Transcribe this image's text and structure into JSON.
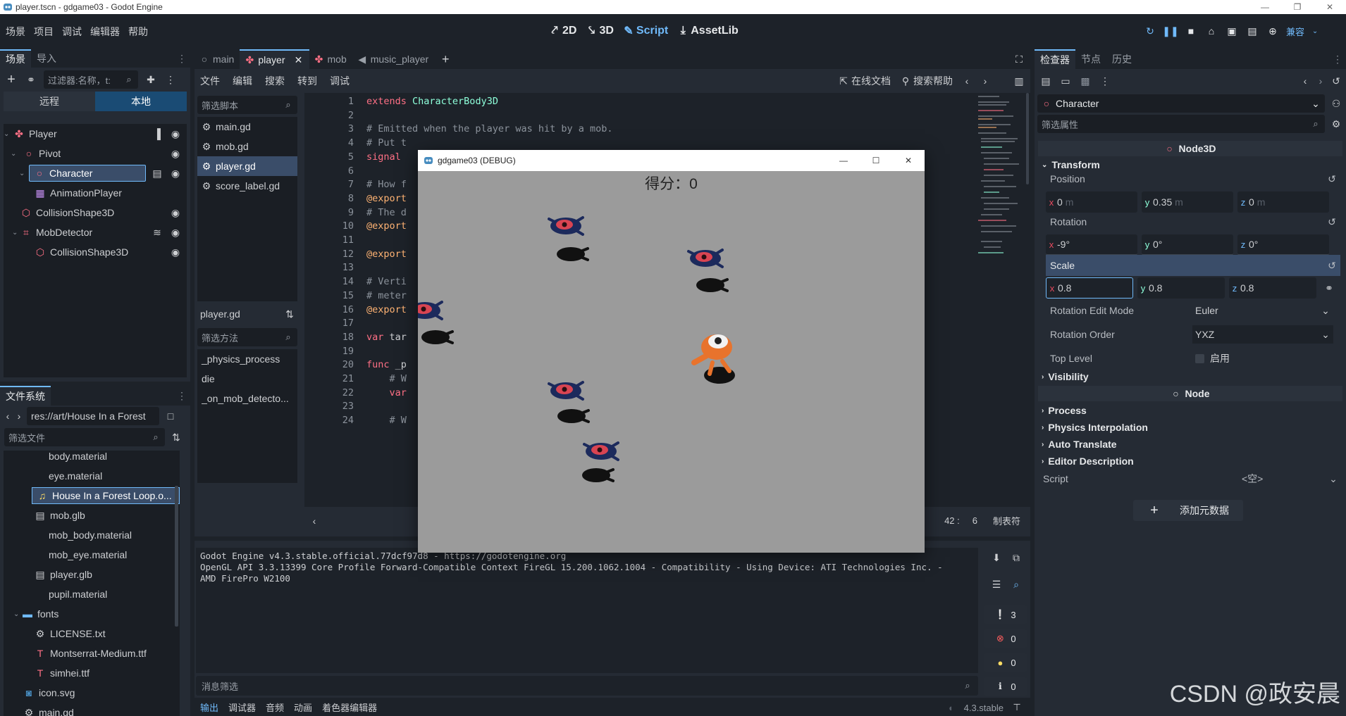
{
  "window_title": "player.tscn - gdgame03 - Godot Engine",
  "menu": [
    "场景",
    "项目",
    "调试",
    "编辑器",
    "帮助"
  ],
  "workspaces": [
    {
      "label": "2D",
      "icon": "2d-icon"
    },
    {
      "label": "3D",
      "icon": "3d-icon"
    },
    {
      "label": "Script",
      "icon": "script-icon"
    },
    {
      "label": "AssetLib",
      "icon": "assetlib-icon"
    }
  ],
  "renderer": "兼容",
  "scene_dock": {
    "tabs": [
      "场景",
      "导入"
    ],
    "filter_placeholder": "过滤器:名称，t:",
    "remote_label": "远程",
    "local_label": "本地",
    "tree": [
      {
        "label": "Player"
      },
      {
        "label": "Pivot"
      },
      {
        "label": "Character"
      },
      {
        "label": "AnimationPlayer"
      },
      {
        "label": "CollisionShape3D"
      },
      {
        "label": "MobDetector"
      },
      {
        "label": "CollisionShape3D"
      }
    ]
  },
  "fs_dock": {
    "title": "文件系统",
    "path": "res://art/House In a Forest",
    "filter_placeholder": "筛选文件",
    "items": [
      {
        "label": "body.material"
      },
      {
        "label": "eye.material"
      },
      {
        "label": "House In a Forest Loop.o..."
      },
      {
        "label": "mob.glb"
      },
      {
        "label": "mob_body.material"
      },
      {
        "label": "mob_eye.material"
      },
      {
        "label": "player.glb"
      },
      {
        "label": "pupil.material"
      },
      {
        "label": "fonts"
      },
      {
        "label": "LICENSE.txt"
      },
      {
        "label": "Montserrat-Medium.ttf"
      },
      {
        "label": "simhei.ttf"
      },
      {
        "label": "icon.svg"
      },
      {
        "label": "main.gd"
      }
    ]
  },
  "script_editor": {
    "tabs": [
      "main",
      "player",
      "mob",
      "music_player"
    ],
    "menu": [
      "文件",
      "编辑",
      "搜索",
      "转到",
      "调试"
    ],
    "online_docs": "在线文档",
    "search_help": "搜索帮助",
    "filter_scripts": "筛选脚本",
    "scripts": [
      "main.gd",
      "mob.gd",
      "player.gd",
      "score_label.gd"
    ],
    "current_script": "player.gd",
    "filter_methods": "筛选方法",
    "methods": [
      "_physics_process",
      "die",
      "_on_mob_detecto..."
    ],
    "line_numbers": [
      "1",
      "2",
      "3",
      "4",
      "5",
      "6",
      "7",
      "8",
      "9",
      "10",
      "11",
      "12",
      "13",
      "14",
      "15",
      "16",
      "17",
      "18",
      "19",
      "20",
      "21",
      "22",
      "23",
      "24"
    ],
    "code_lines": [
      "extends CharacterBody3D",
      "",
      "# Emitted when the player was hit by a mob.",
      "# Put t",
      "signal ",
      "",
      "# How f",
      "@export",
      "# The d",
      "@export",
      "",
      "@export",
      "",
      "# Verti",
      "# meter",
      "@export",
      "",
      "var tar",
      "",
      "func _p",
      "\t# W",
      "\tvar",
      "",
      "\t# W"
    ],
    "status_line": "42 :",
    "status_col": "6",
    "status_tab": "制表符"
  },
  "output": {
    "lines": [
      "Godot Engine v4.3.stable.official.77dcf97d8 - https://godotengine.org",
      "OpenGL API 3.3.13399 Core Profile Forward-Compatible Context FireGL 15.200.1062.1004 - Compatibility - Using Device: ATI Technologies Inc. -",
      "AMD FirePro W2100"
    ],
    "filter_placeholder": "消息筛选",
    "counts": [
      "3",
      "0",
      "0",
      "0"
    ],
    "bottom_tabs": [
      "输出",
      "调试器",
      "音频",
      "动画",
      "着色器编辑器"
    ],
    "version": "4.3.stable"
  },
  "inspector": {
    "tabs": [
      "检查器",
      "节点",
      "历史"
    ],
    "node_name": "Character",
    "filter_placeholder": "筛选属性",
    "section_node3d": "Node3D",
    "transform": "Transform",
    "position_label": "Position",
    "position": {
      "x": "0",
      "y": "0.35",
      "z": "0",
      "unit": "m"
    },
    "rotation_label": "Rotation",
    "rotation": {
      "x": "-9°",
      "y": "0°",
      "z": "0°"
    },
    "scale_label": "Scale",
    "scale": {
      "x": "0.8",
      "y": "0.8",
      "z": "0.8"
    },
    "rot_edit_mode_label": "Rotation Edit Mode",
    "rot_edit_mode": "Euler",
    "rot_order_label": "Rotation Order",
    "rot_order": "YXZ",
    "top_level_label": "Top Level",
    "top_level_value": "启用",
    "visibility": "Visibility",
    "section_node": "Node",
    "process": "Process",
    "physics_interp": "Physics Interpolation",
    "auto_translate": "Auto Translate",
    "editor_desc": "Editor Description",
    "script_label": "Script",
    "script_value": "<空>",
    "add_metadata": "添加元数据"
  },
  "game_window": {
    "title": "gdgame03 (DEBUG)",
    "score": "得分：0"
  },
  "watermark": "CSDN @政安晨",
  "colors": {
    "accent": "#70bafa",
    "keyword": "#ff7085",
    "type": "#8effda",
    "comment": "#8c939c",
    "annotation": "#ffb373"
  }
}
